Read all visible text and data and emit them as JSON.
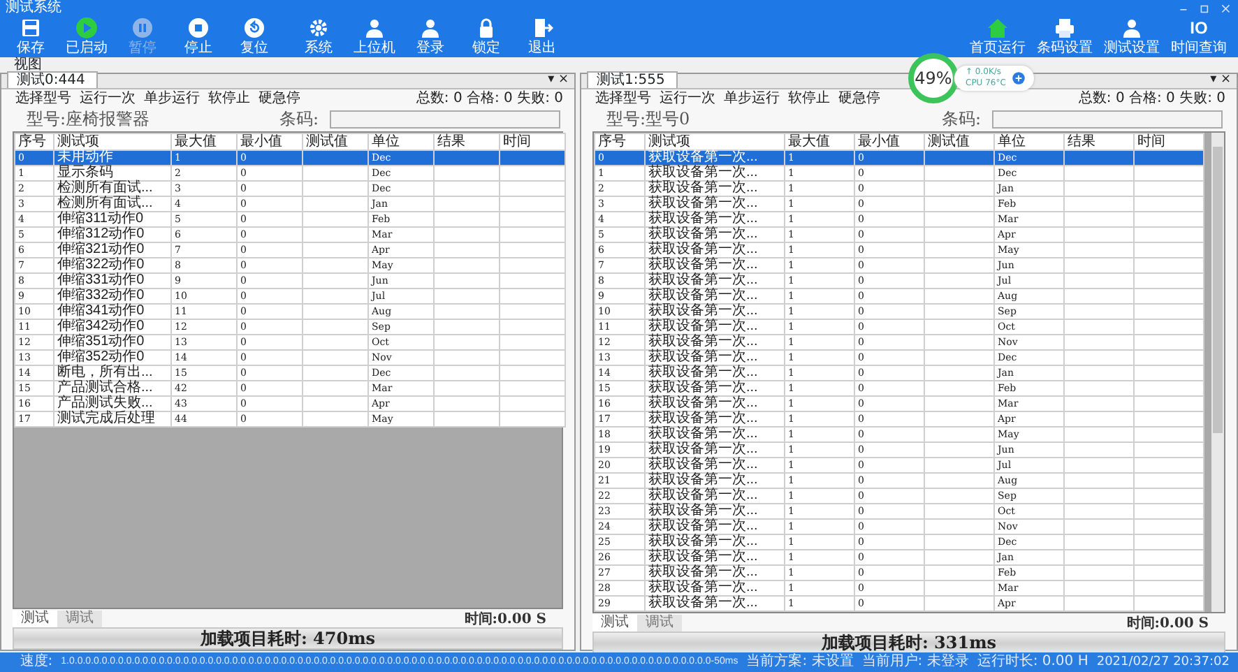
{
  "window": {
    "title": "测试系统"
  },
  "toolbar": [
    {
      "label": "保存",
      "kind": "save",
      "disabled": false
    },
    {
      "label": "已启动",
      "kind": "play",
      "disabled": false
    },
    {
      "label": "暂停",
      "kind": "pause",
      "disabled": true
    },
    {
      "label": "停止",
      "kind": "stop",
      "disabled": false
    },
    {
      "label": "复位",
      "kind": "reset",
      "disabled": false
    },
    {
      "label": "系统",
      "kind": "gear",
      "disabled": false
    },
    {
      "label": "上位机",
      "kind": "user",
      "disabled": false
    },
    {
      "label": "登录",
      "kind": "user",
      "disabled": false
    },
    {
      "label": "锁定",
      "kind": "lock",
      "disabled": false
    },
    {
      "label": "退出",
      "kind": "exit",
      "disabled": false
    }
  ],
  "right_toolbar": [
    {
      "label": "首页运行",
      "kind": "home"
    },
    {
      "label": "条码设置",
      "kind": "printer"
    },
    {
      "label": "测试设置",
      "kind": "user"
    },
    {
      "label": "时间查询",
      "kind": "text",
      "glyph": "IO"
    }
  ],
  "menu": [
    "视图"
  ],
  "monitor": {
    "percent": "49%",
    "net": "↑ 0.0K/s",
    "cpu": "CPU 76°C"
  },
  "panels": [
    {
      "tab": "测试0:444",
      "tab_buttons": "▾ ×",
      "actions": [
        "选择型号",
        "运行一次",
        "单步运行",
        "软停止",
        "硬急停"
      ],
      "counts": "总数: 0 合格: 0 失败: 0",
      "model": "型号:座椅报警器",
      "barcode_label": "条码:",
      "scrollbar": false,
      "columns": [
        "序号",
        "测试项",
        "最大值",
        "最小值",
        "测试值",
        "单位",
        "结果",
        "时间"
      ],
      "rows": [
        {
          "no": "0",
          "item": "未用动作",
          "max": "1",
          "min": "0",
          "unit": "Dec",
          "selected": true
        },
        {
          "no": "1",
          "item": "显示条码",
          "max": "2",
          "min": "0",
          "unit": "Dec",
          "selected": false
        },
        {
          "no": "2",
          "item": "检测所有面试...",
          "max": "3",
          "min": "0",
          "unit": "Dec",
          "selected": false
        },
        {
          "no": "3",
          "item": "检测所有面试...",
          "max": "4",
          "min": "0",
          "unit": "Jan",
          "selected": false
        },
        {
          "no": "4",
          "item": "伸缩311动作0",
          "max": "5",
          "min": "0",
          "unit": "Feb",
          "selected": false
        },
        {
          "no": "5",
          "item": "伸缩312动作0",
          "max": "6",
          "min": "0",
          "unit": "Mar",
          "selected": false
        },
        {
          "no": "6",
          "item": "伸缩321动作0",
          "max": "7",
          "min": "0",
          "unit": "Apr",
          "selected": false
        },
        {
          "no": "7",
          "item": "伸缩322动作0",
          "max": "8",
          "min": "0",
          "unit": "May",
          "selected": false
        },
        {
          "no": "8",
          "item": "伸缩331动作0",
          "max": "9",
          "min": "0",
          "unit": "Jun",
          "selected": false
        },
        {
          "no": "9",
          "item": "伸缩332动作0",
          "max": "10",
          "min": "0",
          "unit": "Jul",
          "selected": false
        },
        {
          "no": "10",
          "item": "伸缩341动作0",
          "max": "11",
          "min": "0",
          "unit": "Aug",
          "selected": false
        },
        {
          "no": "11",
          "item": "伸缩342动作0",
          "max": "12",
          "min": "0",
          "unit": "Sep",
          "selected": false
        },
        {
          "no": "12",
          "item": "伸缩351动作0",
          "max": "13",
          "min": "0",
          "unit": "Oct",
          "selected": false
        },
        {
          "no": "13",
          "item": "伸缩352动作0",
          "max": "14",
          "min": "0",
          "unit": "Nov",
          "selected": false
        },
        {
          "no": "14",
          "item": "断电，所有出...",
          "max": "15",
          "min": "0",
          "unit": "Dec",
          "selected": false
        },
        {
          "no": "15",
          "item": "产品测试合格...",
          "max": "42",
          "min": "0",
          "unit": "Mar",
          "selected": false
        },
        {
          "no": "16",
          "item": "产品测试失败...",
          "max": "43",
          "min": "0",
          "unit": "Apr",
          "selected": false
        },
        {
          "no": "17",
          "item": "测试完成后处理",
          "max": "44",
          "min": "0",
          "unit": "May",
          "selected": false
        }
      ],
      "bottom_tabs": [
        {
          "label": "测试",
          "selected": true
        },
        {
          "label": "调试",
          "selected": false
        }
      ],
      "time": "时间:0.00 S",
      "load_time": "加载项目耗时: 470ms"
    },
    {
      "tab": "测试1:555",
      "tab_buttons": "▾ ×",
      "actions": [
        "选择型号",
        "运行一次",
        "单步运行",
        "软停止",
        "硬急停"
      ],
      "counts": "总数: 0 合格: 0 失败: 0",
      "model": "型号:型号0",
      "barcode_label": "条码:",
      "scrollbar": true,
      "columns": [
        "序号",
        "测试项",
        "最大值",
        "最小值",
        "测试值",
        "单位",
        "结果",
        "时间"
      ],
      "rows": [
        {
          "no": "0",
          "item": "获取设备第一次...",
          "max": "1",
          "min": "0",
          "unit": "Dec",
          "selected": true
        },
        {
          "no": "1",
          "item": "获取设备第一次...",
          "max": "1",
          "min": "0",
          "unit": "Dec",
          "selected": false
        },
        {
          "no": "2",
          "item": "获取设备第一次...",
          "max": "1",
          "min": "0",
          "unit": "Jan",
          "selected": false
        },
        {
          "no": "3",
          "item": "获取设备第一次...",
          "max": "1",
          "min": "0",
          "unit": "Feb",
          "selected": false
        },
        {
          "no": "4",
          "item": "获取设备第一次...",
          "max": "1",
          "min": "0",
          "unit": "Mar",
          "selected": false
        },
        {
          "no": "5",
          "item": "获取设备第一次...",
          "max": "1",
          "min": "0",
          "unit": "Apr",
          "selected": false
        },
        {
          "no": "6",
          "item": "获取设备第一次...",
          "max": "1",
          "min": "0",
          "unit": "May",
          "selected": false
        },
        {
          "no": "7",
          "item": "获取设备第一次...",
          "max": "1",
          "min": "0",
          "unit": "Jun",
          "selected": false
        },
        {
          "no": "8",
          "item": "获取设备第一次...",
          "max": "1",
          "min": "0",
          "unit": "Jul",
          "selected": false
        },
        {
          "no": "9",
          "item": "获取设备第一次...",
          "max": "1",
          "min": "0",
          "unit": "Aug",
          "selected": false
        },
        {
          "no": "10",
          "item": "获取设备第一次...",
          "max": "1",
          "min": "0",
          "unit": "Sep",
          "selected": false
        },
        {
          "no": "11",
          "item": "获取设备第一次...",
          "max": "1",
          "min": "0",
          "unit": "Oct",
          "selected": false
        },
        {
          "no": "12",
          "item": "获取设备第一次...",
          "max": "1",
          "min": "0",
          "unit": "Nov",
          "selected": false
        },
        {
          "no": "13",
          "item": "获取设备第一次...",
          "max": "1",
          "min": "0",
          "unit": "Dec",
          "selected": false
        },
        {
          "no": "14",
          "item": "获取设备第一次...",
          "max": "1",
          "min": "0",
          "unit": "Jan",
          "selected": false
        },
        {
          "no": "15",
          "item": "获取设备第一次...",
          "max": "1",
          "min": "0",
          "unit": "Feb",
          "selected": false
        },
        {
          "no": "16",
          "item": "获取设备第一次...",
          "max": "1",
          "min": "0",
          "unit": "Mar",
          "selected": false
        },
        {
          "no": "17",
          "item": "获取设备第一次...",
          "max": "1",
          "min": "0",
          "unit": "Apr",
          "selected": false
        },
        {
          "no": "18",
          "item": "获取设备第一次...",
          "max": "1",
          "min": "0",
          "unit": "May",
          "selected": false
        },
        {
          "no": "19",
          "item": "获取设备第一次...",
          "max": "1",
          "min": "0",
          "unit": "Jun",
          "selected": false
        },
        {
          "no": "20",
          "item": "获取设备第一次...",
          "max": "1",
          "min": "0",
          "unit": "Jul",
          "selected": false
        },
        {
          "no": "21",
          "item": "获取设备第一次...",
          "max": "1",
          "min": "0",
          "unit": "Aug",
          "selected": false
        },
        {
          "no": "22",
          "item": "获取设备第一次...",
          "max": "1",
          "min": "0",
          "unit": "Sep",
          "selected": false
        },
        {
          "no": "23",
          "item": "获取设备第一次...",
          "max": "1",
          "min": "0",
          "unit": "Oct",
          "selected": false
        },
        {
          "no": "24",
          "item": "获取设备第一次...",
          "max": "1",
          "min": "0",
          "unit": "Nov",
          "selected": false
        },
        {
          "no": "25",
          "item": "获取设备第一次...",
          "max": "1",
          "min": "0",
          "unit": "Dec",
          "selected": false
        },
        {
          "no": "26",
          "item": "获取设备第一次...",
          "max": "1",
          "min": "0",
          "unit": "Jan",
          "selected": false
        },
        {
          "no": "27",
          "item": "获取设备第一次...",
          "max": "1",
          "min": "0",
          "unit": "Feb",
          "selected": false
        },
        {
          "no": "28",
          "item": "获取设备第一次...",
          "max": "1",
          "min": "0",
          "unit": "Mar",
          "selected": false
        },
        {
          "no": "29",
          "item": "获取设备第一次...",
          "max": "1",
          "min": "0",
          "unit": "Apr",
          "selected": false
        }
      ],
      "bottom_tabs": [
        {
          "label": "测试",
          "selected": true
        },
        {
          "label": "调试",
          "selected": false
        }
      ],
      "time": "时间:0.00 S",
      "load_time": "加载项目耗时: 331ms"
    }
  ],
  "status_bar": {
    "speed_label": "速度:",
    "speed": "1.0.0.0.0.0.0.0.0.0.0.0.0.0.0.0.0.0.0.0.0.0.0.0.0.0.0.0.0.0.0.0.0.0.0.0.0.0.0.0.0.0.0.0.0.0.0.0.0.0.0.0.0.0.0.0.0.0.0.0.0.0.0.0.0.0.0.0.0.0.0.0.0.0.0.0.0.0.0.0-50ms",
    "items": [
      "当前方案: 未设置",
      "当前用户: 未登录",
      "运行时长: 0.00 H",
      "2021/02/27 20:37:02"
    ]
  }
}
